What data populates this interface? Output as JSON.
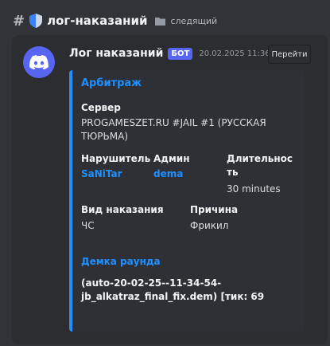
{
  "header": {
    "hash_symbol": "#",
    "channel_name": "лог-наказаний",
    "follow_label": "следящий"
  },
  "message": {
    "author": "Лог наказаний",
    "badge": "БОТ",
    "timestamp": "20.02.2025 11:36",
    "goto_button": "Перейти"
  },
  "embed": {
    "accent_color": "#1e90ff",
    "title": "Арбитраж",
    "server_label": "Сервер",
    "server_line1": "PROGAMESZET.RU #JAIL #1 (РУССКАЯ",
    "server_line2": "ТЮРЬМА)",
    "violator_label": "Нарушитель",
    "violator_value": "SaNiTar",
    "admin_label": "Админ",
    "admin_value": "dema",
    "duration_label_line1": "Длительнос",
    "duration_label_line2": "ть",
    "duration_value": "30 minutes",
    "punishment_label": "Вид наказания",
    "punishment_value": "ЧС",
    "reason_label": "Причина",
    "reason_value": "Фрикил",
    "demo_label": "Демка раунда",
    "demo_line1": "(auto-20-02-25--11-34-54-",
    "demo_line2": "jb_alkatraz_final_fix.dem) [тик: 69"
  },
  "icons": {
    "shield": "shield-icon",
    "folder": "folder-icon",
    "avatar": "discord-logo-icon"
  }
}
